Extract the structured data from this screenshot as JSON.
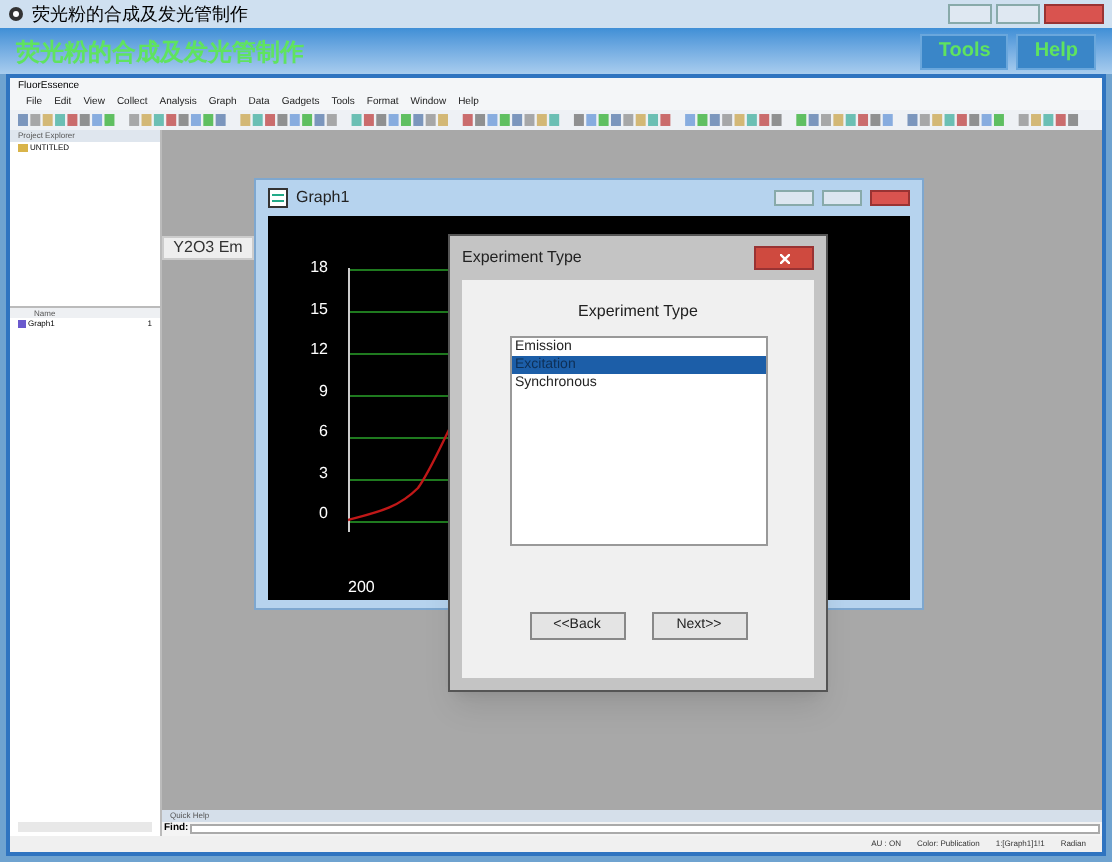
{
  "window": {
    "title": "荧光粉的合成及发光管制作"
  },
  "banner": {
    "title": "荧光粉的合成及发光管制作",
    "buttons": [
      "Tools",
      "Help"
    ]
  },
  "app": {
    "title": "FluorEssence",
    "menu": [
      "File",
      "Edit",
      "View",
      "Collect",
      "Analysis",
      "Graph",
      "Data",
      "Gadgets",
      "Tools",
      "Format",
      "Window",
      "Help"
    ]
  },
  "project_explorer": {
    "title": "Project Explorer",
    "folder": "UNTITLED",
    "column": "Name",
    "items": [
      {
        "name": "Graph1",
        "count": "1"
      }
    ]
  },
  "side_button": "Y2O3 Em",
  "graph_window": {
    "title": "Graph1",
    "yticks": [
      "18",
      "15",
      "12",
      "9",
      "6",
      "3",
      "0"
    ],
    "xticks": [
      "200"
    ]
  },
  "dialog": {
    "title": "Experiment Type",
    "heading": "Experiment Type",
    "options": [
      {
        "label": "Emission",
        "selected": false
      },
      {
        "label": "Excitation",
        "selected": true
      },
      {
        "label": "Synchronous",
        "selected": false
      }
    ],
    "buttons": [
      "<<Back",
      "Next>>"
    ]
  },
  "quick_help": {
    "title": "Quick Help",
    "find_label": "Find:"
  },
  "status_bar": [
    "AU : ON",
    "Color: Publication",
    "1:[Graph1]1!1",
    "Radian"
  ]
}
